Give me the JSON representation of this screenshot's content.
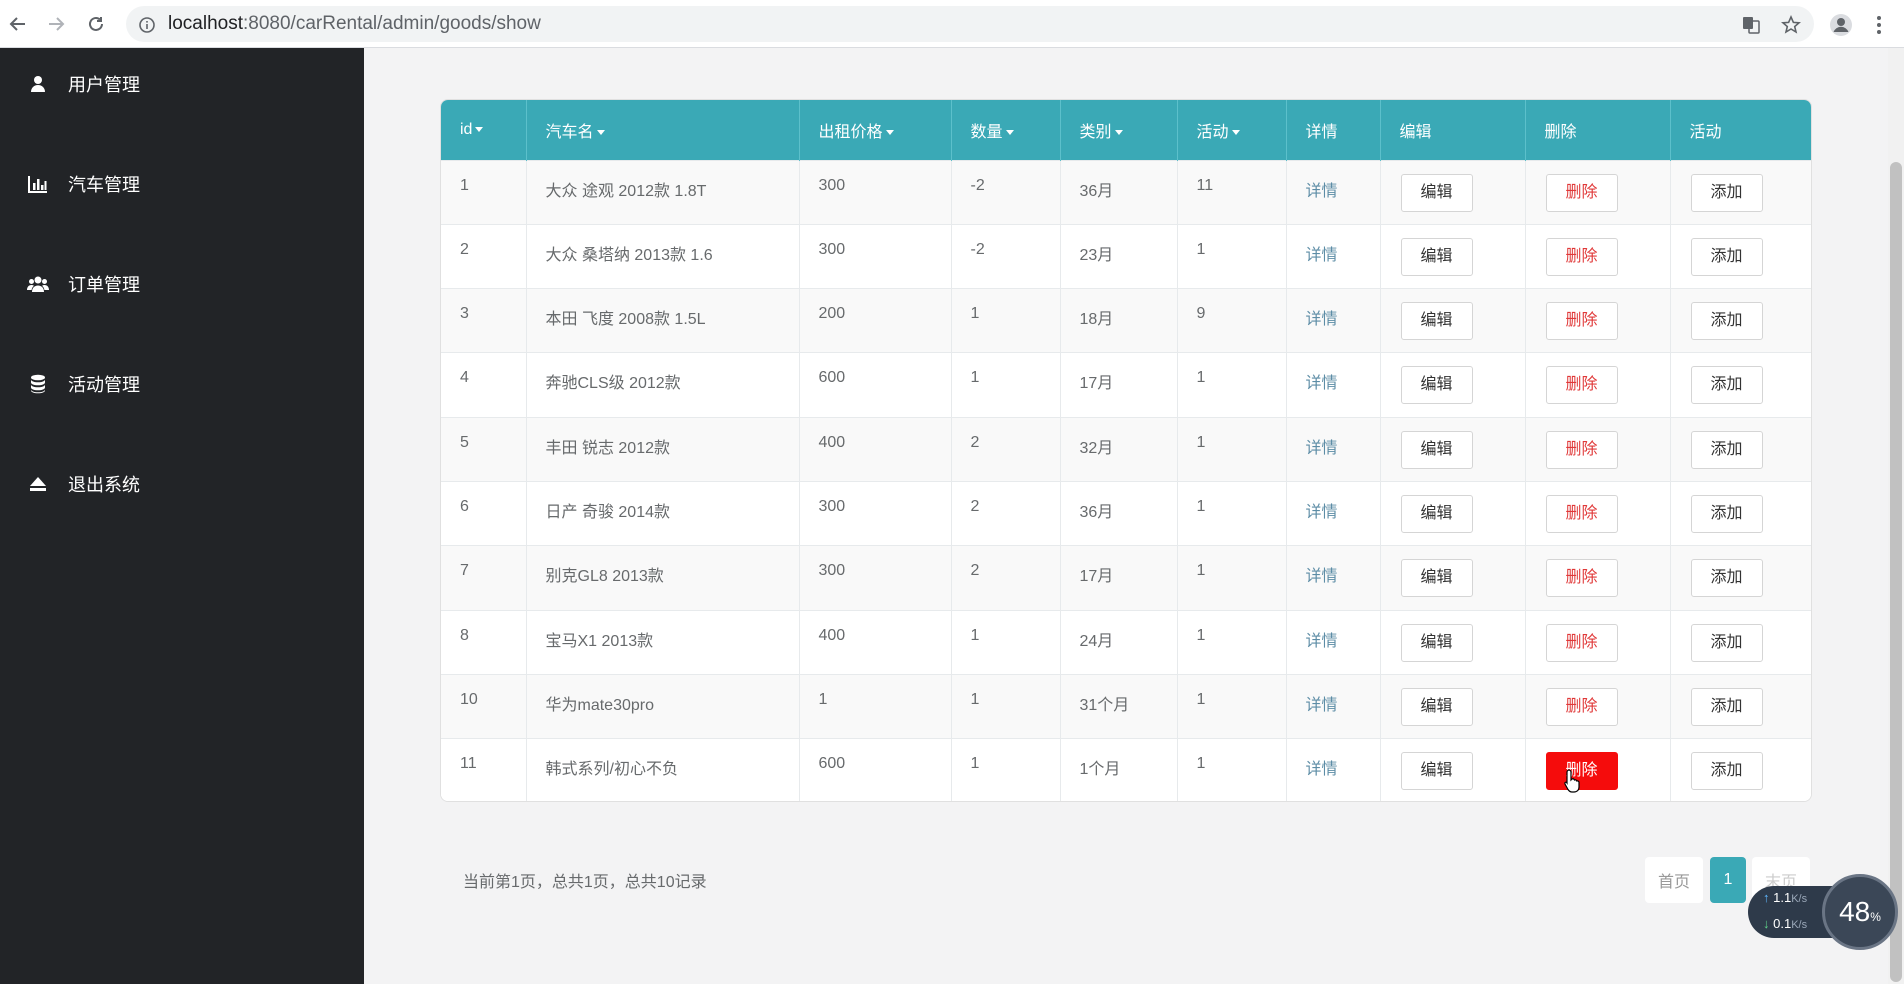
{
  "browser": {
    "url_host": "localhost",
    "url_path": ":8080/carRental/admin/goods/show"
  },
  "sidebar": {
    "items": [
      {
        "label": "用户管理",
        "icon": "user-icon"
      },
      {
        "label": "汽车管理",
        "icon": "bar-chart-icon"
      },
      {
        "label": "订单管理",
        "icon": "users-icon"
      },
      {
        "label": "活动管理",
        "icon": "database-icon"
      },
      {
        "label": "退出系统",
        "icon": "eject-icon"
      }
    ]
  },
  "table": {
    "headers": [
      "id",
      "汽车名",
      "出租价格",
      "数量",
      "类别",
      "活动",
      "详情",
      "编辑",
      "删除",
      "活动"
    ],
    "rows": [
      {
        "id": "1",
        "name": "大众 途观 2012款 1.8T",
        "price": "300",
        "qty": "-2",
        "category": "36月",
        "activity": "11",
        "detail": "详情"
      },
      {
        "id": "2",
        "name": "大众 桑塔纳 2013款 1.6",
        "price": "300",
        "qty": "-2",
        "category": "23月",
        "activity": "1",
        "detail": "详情"
      },
      {
        "id": "3",
        "name": "本田 飞度 2008款 1.5L",
        "price": "200",
        "qty": "1",
        "category": "18月",
        "activity": "9",
        "detail": "详情"
      },
      {
        "id": "4",
        "name": "奔驰CLS级 2012款",
        "price": "600",
        "qty": "1",
        "category": "17月",
        "activity": "1",
        "detail": "详情"
      },
      {
        "id": "5",
        "name": "丰田 锐志 2012款",
        "price": "400",
        "qty": "2",
        "category": "32月",
        "activity": "1",
        "detail": "详情"
      },
      {
        "id": "6",
        "name": "日产 奇骏 2014款",
        "price": "300",
        "qty": "2",
        "category": "36月",
        "activity": "1",
        "detail": "详情"
      },
      {
        "id": "7",
        "name": "别克GL8 2013款",
        "price": "300",
        "qty": "2",
        "category": "17月",
        "activity": "1",
        "detail": "详情"
      },
      {
        "id": "8",
        "name": "宝马X1 2013款",
        "price": "400",
        "qty": "1",
        "category": "24月",
        "activity": "1",
        "detail": "详情"
      },
      {
        "id": "10",
        "name": "华为mate30pro",
        "price": "1",
        "qty": "1",
        "category": "31个月",
        "activity": "1",
        "detail": "详情"
      },
      {
        "id": "11",
        "name": "韩式系列/初心不负",
        "price": "600",
        "qty": "1",
        "category": "1个月",
        "activity": "1",
        "detail": "详情"
      }
    ],
    "edit_label": "编辑",
    "delete_label": "删除",
    "add_label": "添加"
  },
  "pagination": {
    "info": "当前第1页，总共1页，总共10记录",
    "first": "首页",
    "current": "1",
    "last": "末页"
  },
  "speed_widget": {
    "up": "1.1",
    "down": "0.1",
    "unit": "K/s",
    "percent": "48",
    "percent_sign": "%"
  },
  "colors": {
    "header_teal": "#3aa9b6",
    "sidebar_dark": "#222427",
    "delete_red": "#f50c0c"
  }
}
